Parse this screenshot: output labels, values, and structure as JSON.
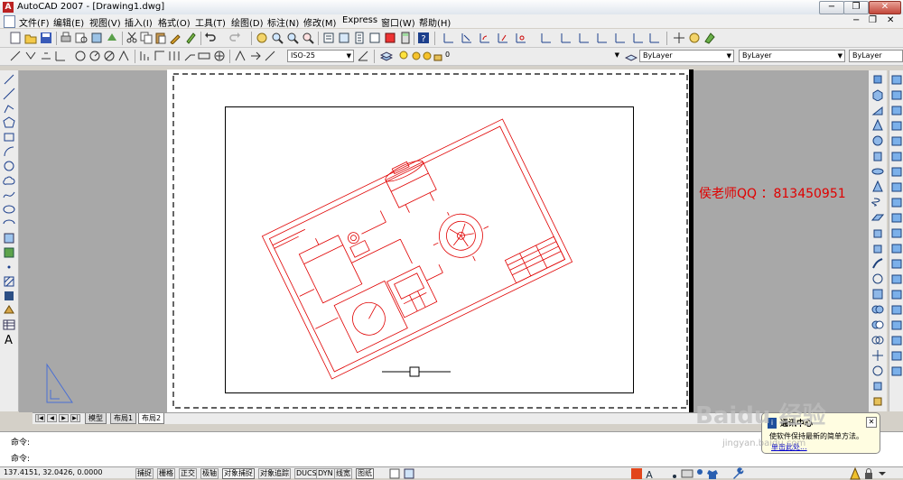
{
  "window": {
    "title": "AutoCAD 2007 - [Drawing1.dwg]",
    "app_icon": "A",
    "minimize_label": "−",
    "restore_label": "❐",
    "close_label": "✕"
  },
  "menu": {
    "items": [
      "文件(F)",
      "编辑(E)",
      "视图(V)",
      "插入(I)",
      "格式(O)",
      "工具(T)",
      "绘图(D)",
      "标注(N)",
      "修改(M)",
      "Express",
      "窗口(W)",
      "帮助(H)"
    ],
    "doc_minimize": "−",
    "doc_restore": "❐",
    "doc_close": "✕"
  },
  "toolbars": {
    "dim_style": "ISO-25",
    "layer": "0",
    "color": "ByLayer",
    "linetype": "ByLayer",
    "lineweight": "ByLayer"
  },
  "drawing": {
    "teacher_label": "侯老师QQ ：813450951",
    "line_color": "#e00000"
  },
  "tabs": {
    "nav": [
      "|◀",
      "◀",
      "▶",
      "▶|"
    ],
    "items": [
      "模型",
      "布局1",
      "布局2"
    ],
    "active": "布局2"
  },
  "command": {
    "prompt1": "命令:",
    "prompt2": "命令:"
  },
  "status": {
    "coords": "137.4151, 32.0426, 0.0000",
    "toggles": [
      "捕捉",
      "栅格",
      "正交",
      "极轴",
      "对象捕捉",
      "对象追踪",
      "DUCS",
      "DYN",
      "线宽",
      "图纸"
    ],
    "active_toggles": [
      "对象捕捉",
      "图纸"
    ]
  },
  "balloon": {
    "title": "通讯中心",
    "message": "使软件保持最新的简单方法。",
    "link": "单击此处...",
    "close": "✕"
  },
  "watermark": {
    "brand": "Baidu 经验",
    "url": "jingyan.baidu.com"
  }
}
